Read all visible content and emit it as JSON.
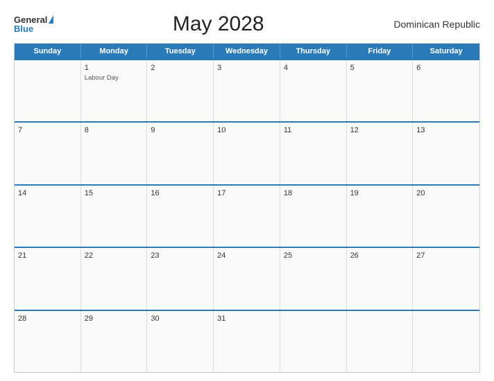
{
  "header": {
    "logo_general": "General",
    "logo_blue": "Blue",
    "title": "May 2028",
    "country": "Dominican Republic"
  },
  "days_of_week": [
    "Sunday",
    "Monday",
    "Tuesday",
    "Wednesday",
    "Thursday",
    "Friday",
    "Saturday"
  ],
  "weeks": [
    [
      {
        "day": "",
        "event": ""
      },
      {
        "day": "1",
        "event": "Labour Day"
      },
      {
        "day": "2",
        "event": ""
      },
      {
        "day": "3",
        "event": ""
      },
      {
        "day": "4",
        "event": ""
      },
      {
        "day": "5",
        "event": ""
      },
      {
        "day": "6",
        "event": ""
      }
    ],
    [
      {
        "day": "7",
        "event": ""
      },
      {
        "day": "8",
        "event": ""
      },
      {
        "day": "9",
        "event": ""
      },
      {
        "day": "10",
        "event": ""
      },
      {
        "day": "11",
        "event": ""
      },
      {
        "day": "12",
        "event": ""
      },
      {
        "day": "13",
        "event": ""
      }
    ],
    [
      {
        "day": "14",
        "event": ""
      },
      {
        "day": "15",
        "event": ""
      },
      {
        "day": "16",
        "event": ""
      },
      {
        "day": "17",
        "event": ""
      },
      {
        "day": "18",
        "event": ""
      },
      {
        "day": "19",
        "event": ""
      },
      {
        "day": "20",
        "event": ""
      }
    ],
    [
      {
        "day": "21",
        "event": ""
      },
      {
        "day": "22",
        "event": ""
      },
      {
        "day": "23",
        "event": ""
      },
      {
        "day": "24",
        "event": ""
      },
      {
        "day": "25",
        "event": ""
      },
      {
        "day": "26",
        "event": ""
      },
      {
        "day": "27",
        "event": ""
      }
    ],
    [
      {
        "day": "28",
        "event": ""
      },
      {
        "day": "29",
        "event": ""
      },
      {
        "day": "30",
        "event": ""
      },
      {
        "day": "31",
        "event": ""
      },
      {
        "day": "",
        "event": ""
      },
      {
        "day": "",
        "event": ""
      },
      {
        "day": "",
        "event": ""
      }
    ]
  ],
  "colors": {
    "header_blue": "#2a7ab8",
    "border": "#ccc",
    "bg_cell": "#f9f9f9"
  }
}
